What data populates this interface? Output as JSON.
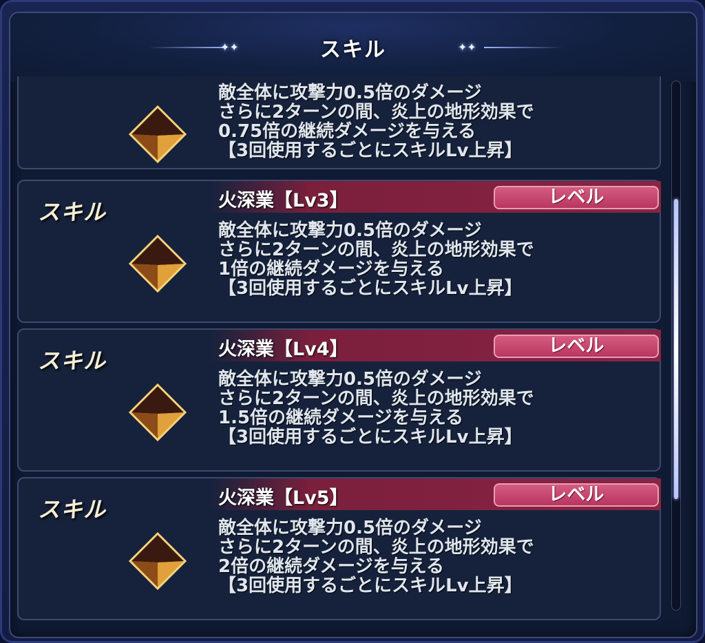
{
  "header": {
    "title": "スキル"
  },
  "cards": [
    {
      "label": "",
      "name": "",
      "level_button": "",
      "description": [
        "敵全体に攻撃力0.5倍のダメージ",
        "さらに2ターンの間、炎上の地形効果で",
        "0.75倍の継続ダメージを与える",
        "【3回使用するごとにスキルLv上昇】"
      ]
    },
    {
      "label": "スキル",
      "name": "火深業【Lv3】",
      "level_button": "レベル",
      "description": [
        "敵全体に攻撃力0.5倍のダメージ",
        "さらに2ターンの間、炎上の地形効果で",
        "1倍の継続ダメージを与える",
        "【3回使用するごとにスキルLv上昇】"
      ]
    },
    {
      "label": "スキル",
      "name": "火深業【Lv4】",
      "level_button": "レベル",
      "description": [
        "敵全体に攻撃力0.5倍のダメージ",
        "さらに2ターンの間、炎上の地形効果で",
        "1.5倍の継続ダメージを与える",
        "【3回使用するごとにスキルLv上昇】"
      ]
    },
    {
      "label": "スキル",
      "name": "火深業【Lv5】",
      "level_button": "レベル",
      "description": [
        "敵全体に攻撃力0.5倍のダメージ",
        "さらに2ターンの間、炎上の地形効果で",
        "2倍の継続ダメージを与える",
        "【3回使用するごとにスキルLv上昇】"
      ]
    }
  ],
  "icons": {
    "gem": "fire-gem-icon",
    "sparkle": "sparkle-icon"
  },
  "colors": {
    "name_bar": "#8a2444",
    "level_button": "#c84470",
    "panel": "#16223c"
  }
}
